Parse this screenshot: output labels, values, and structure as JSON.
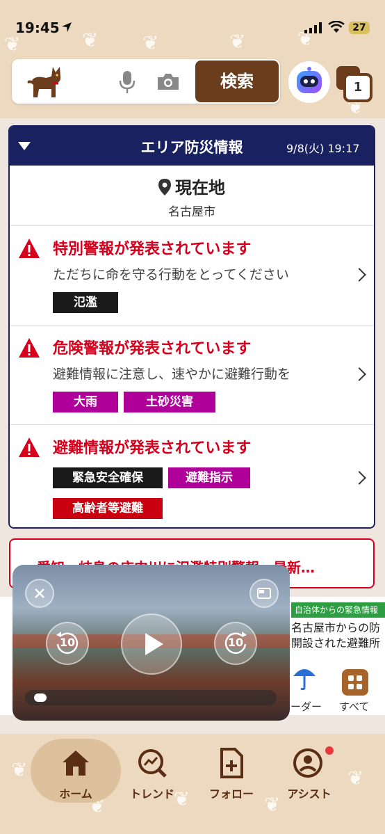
{
  "status_bar": {
    "time": "19:45",
    "battery": "27"
  },
  "header": {
    "search_button": "検索",
    "tab_count": "1"
  },
  "bosai": {
    "title": "エリア防災情報",
    "datetime": "9/8(火) 19:17",
    "location_label": "現在地",
    "location_city": "名古屋市",
    "alerts": [
      {
        "title": "特別警報が発表されています",
        "desc": "ただちに命を守る行動をとってください",
        "tags": [
          "氾濫"
        ]
      },
      {
        "title": "危険警報が発表されています",
        "desc": "避難情報に注意し、速やかに避難行動を",
        "tags": [
          "大雨",
          "土砂災害"
        ]
      },
      {
        "title": "避難情報が発表されています",
        "desc": "",
        "tags": [
          "緊急安全確保",
          "避難指示",
          "高齢者等避難"
        ]
      }
    ]
  },
  "banner": {
    "text": "愛知・岐阜の庄内川に氾濫特別警報　最新…"
  },
  "emergency": {
    "label": "自治体からの緊急情報",
    "line1": "名古屋市からの防",
    "line2": "開設された避難所"
  },
  "shortcuts": {
    "radar": "ーダー",
    "all": "すべて"
  },
  "video": {
    "rewind_seconds": "10",
    "forward_seconds": "10",
    "progress": 0.03
  },
  "tabbar": {
    "home": "ホーム",
    "trend": "トレンド",
    "follow": "フォロー",
    "assist": "アシスト"
  },
  "colors": {
    "navy": "#1a2160",
    "alert_red": "#d6001c",
    "brown": "#6b3d1c",
    "tag_black": "#1a1a1a",
    "tag_purple": "#b0009a",
    "tag_red": "#c8000f"
  }
}
